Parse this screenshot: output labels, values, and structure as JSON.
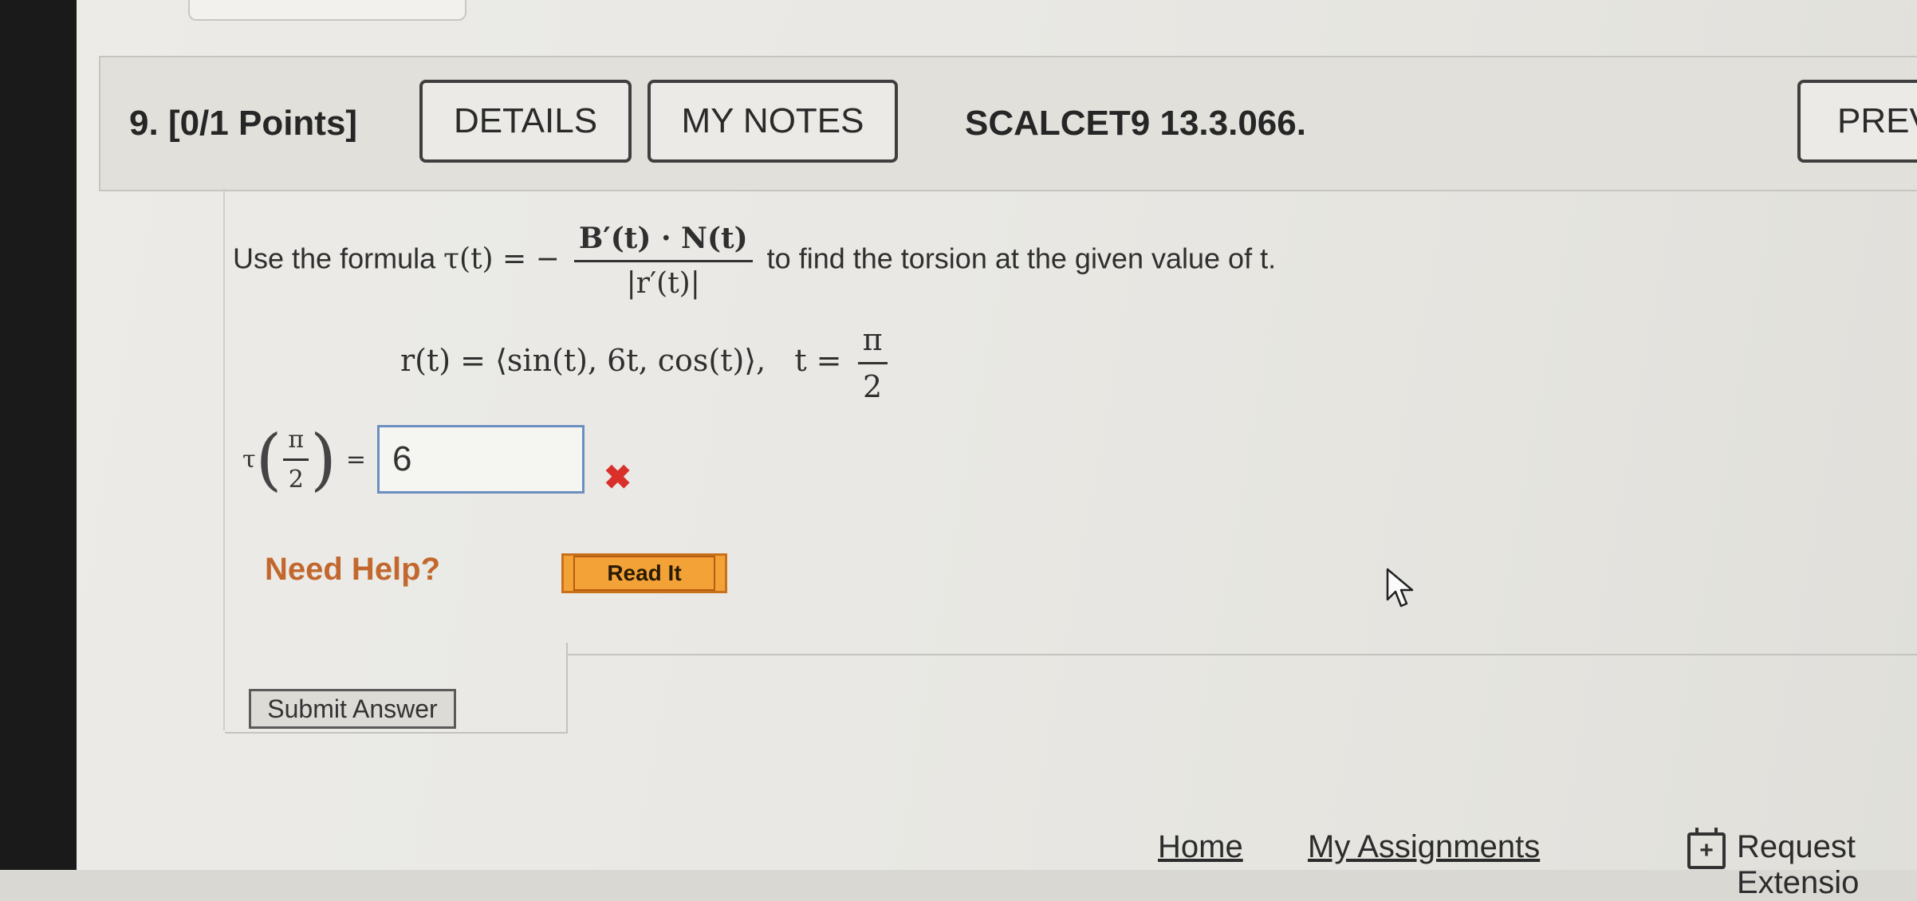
{
  "question": {
    "number": "9.",
    "points": "[0/1 Points]",
    "details_label": "DETAILS",
    "notes_label": "MY NOTES",
    "source": "SCALCET9 13.3.066.",
    "prev_label": "PREV"
  },
  "prompt": {
    "lead": "Use the formula ",
    "formula_lhs": "τ(t) = −",
    "formula_num": "B′(t) · N(t)",
    "formula_den": "|r′(t)|",
    "trail": " to find the torsion at the given value of t."
  },
  "given": {
    "lhs": "r(t) = ⟨sin(t), 6t, cos(t)⟩,",
    "t_eq": "t =",
    "t_num": "π",
    "t_den": "2"
  },
  "answer": {
    "tau": "τ",
    "frac_num": "π",
    "frac_den": "2",
    "equals": "=",
    "value": "6",
    "status_mark": "✖"
  },
  "help": {
    "label": "Need Help?",
    "read_it": "Read It"
  },
  "submit_label": "Submit Answer",
  "footer": {
    "home": "Home",
    "my_assignments": "My Assignments",
    "request_extension": "Request Extensio"
  }
}
